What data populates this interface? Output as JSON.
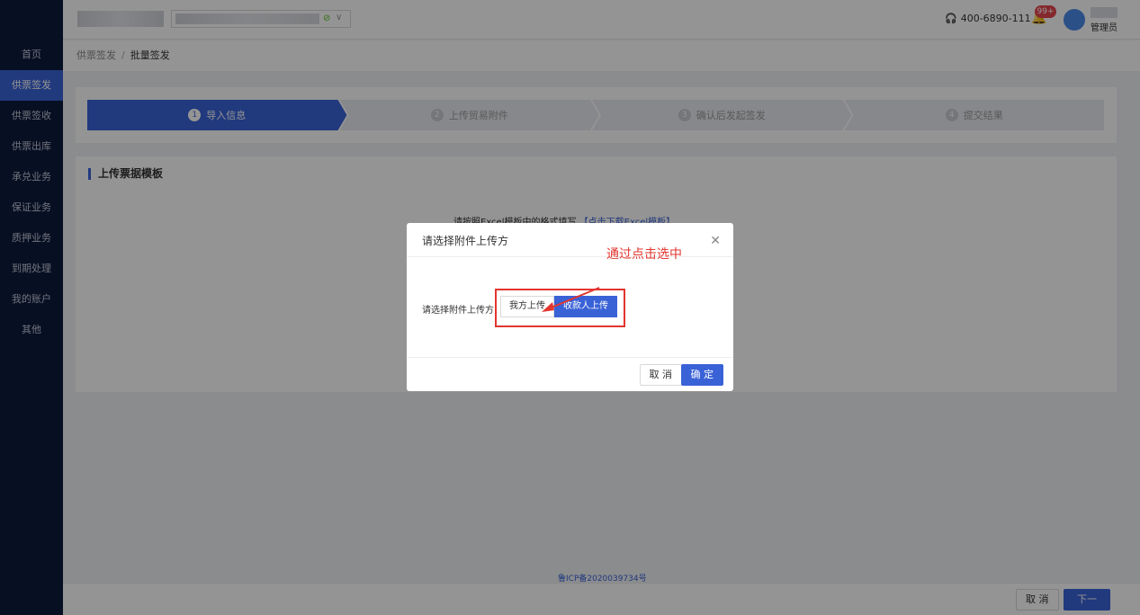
{
  "header": {
    "phone": "400-6890-111",
    "badge": "99+",
    "user_role": "管理员"
  },
  "sidebar": {
    "items": [
      {
        "label": "首页"
      },
      {
        "label": "供票签发"
      },
      {
        "label": "供票签收"
      },
      {
        "label": "供票出库"
      },
      {
        "label": "承兑业务"
      },
      {
        "label": "保证业务"
      },
      {
        "label": "质押业务"
      },
      {
        "label": "到期处理"
      },
      {
        "label": "我的账户"
      },
      {
        "label": "其他"
      }
    ],
    "active": "供票签发"
  },
  "breadcrumb": {
    "parent": "供票签发",
    "separator": "/",
    "current": "批量签发"
  },
  "steps": [
    {
      "num": "1",
      "label": "导入信息"
    },
    {
      "num": "2",
      "label": "上传贸易附件"
    },
    {
      "num": "3",
      "label": "确认后发起签发"
    },
    {
      "num": "4",
      "label": "提交结果"
    }
  ],
  "upload": {
    "title": "上传票据模板",
    "hint": "请按照Excel模板中的格式填写",
    "link": "【点击下载Excel模板】"
  },
  "footer": {
    "icp": "鲁ICP备2020039734号",
    "cancel": "取 消",
    "next": "下一步"
  },
  "modal": {
    "title": "请选择附件上传方",
    "field_label": "请选择附件上传方：",
    "options": [
      "我方上传",
      "收款人上传"
    ],
    "selected": "收款人上传",
    "annotation": "通过点击选中",
    "cancel": "取 消",
    "ok": "确 定"
  },
  "colors": {
    "accent": "#3a62d7",
    "sidebar": "#0d1a3d",
    "annotation": "#e2352f"
  }
}
